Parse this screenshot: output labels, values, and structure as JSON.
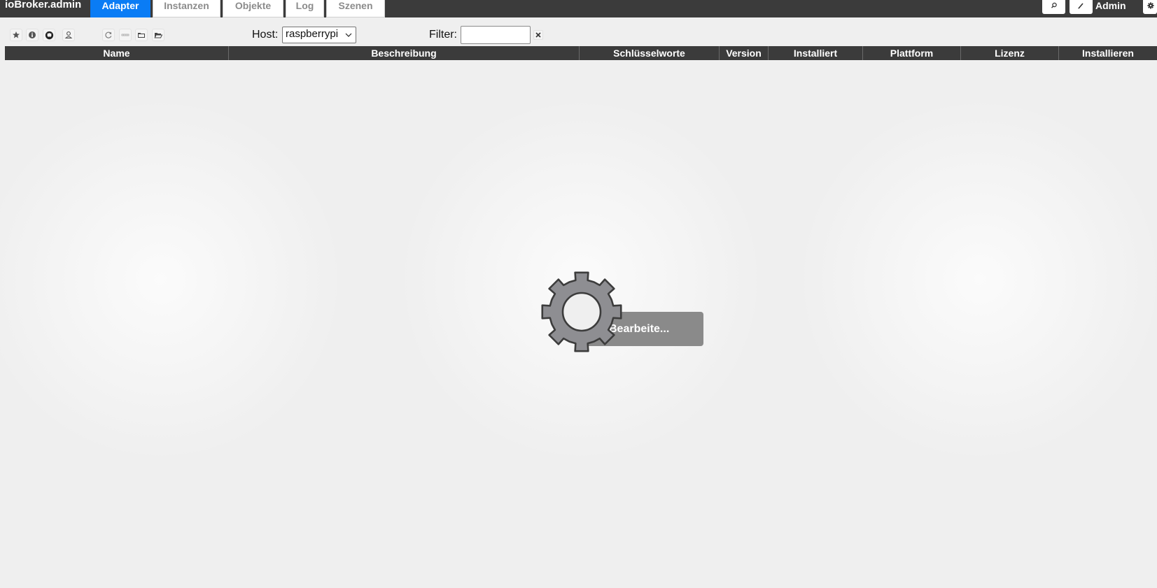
{
  "header": {
    "app_title": "ioBroker.admin",
    "tabs": [
      {
        "label": "Adapter",
        "active": true
      },
      {
        "label": "Instanzen",
        "active": false
      },
      {
        "label": "Objekte",
        "active": false
      },
      {
        "label": "Log",
        "active": false
      },
      {
        "label": "Szenen",
        "active": false
      }
    ],
    "user_label": "Admin",
    "right_icons": [
      "search-icon",
      "edit-icon",
      "gear-icon"
    ]
  },
  "toolbar": {
    "icons": [
      "star-icon",
      "info-icon",
      "github-icon",
      "user-icon",
      "refresh-icon",
      "list-icon",
      "folder-icon",
      "folder-open-icon"
    ],
    "host_label": "Host:",
    "host_value": "raspberrypi",
    "filter_label": "Filter:",
    "filter_value": ""
  },
  "table": {
    "columns": [
      "Name",
      "Beschreibung",
      "Schlüsselworte",
      "Version",
      "Installiert",
      "Plattform",
      "Lizenz",
      "Installieren"
    ],
    "rows": []
  },
  "busy": {
    "text": "Bearbeite...",
    "icon": "gear-icon"
  },
  "colors": {
    "header_bg": "#3b3b3b",
    "active_tab": "#0a7cf5",
    "background": "#efefef",
    "busy_box": "#8a8a8a",
    "gear": "#8e8e92"
  }
}
